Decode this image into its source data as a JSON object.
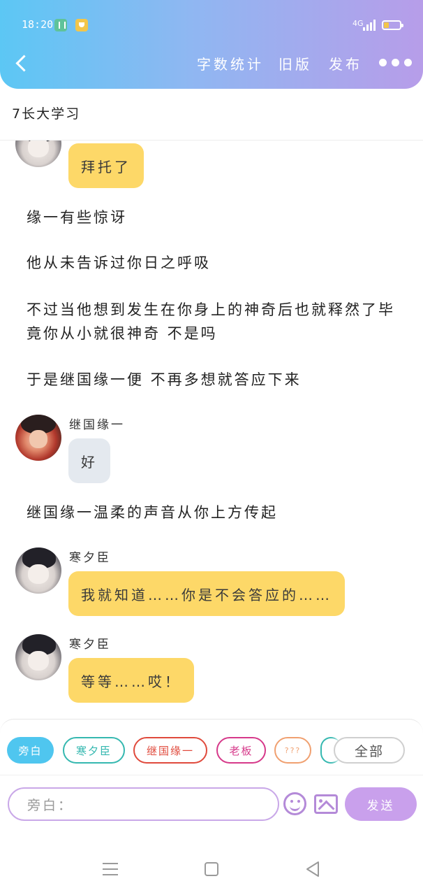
{
  "status_bar": {
    "time": "18:20",
    "network": "4G"
  },
  "header": {
    "nav": {
      "word_count": "字数统计",
      "old_version": "旧版",
      "publish": "发布"
    }
  },
  "story": {
    "title": "7长大学习"
  },
  "messages": [
    {
      "type": "bubble",
      "speaker": "",
      "avatar": "dark",
      "text": "拜托了",
      "style": "yellow"
    },
    {
      "type": "narration",
      "text": "缘一有些惊讶"
    },
    {
      "type": "narration",
      "text": "他从未告诉过你日之呼吸"
    },
    {
      "type": "narration",
      "text": "不过当他想到发生在你身上的神奇后也就释然了毕竟你从小就很神奇 不是吗"
    },
    {
      "type": "narration",
      "text": "于是继国缘一便 不再多想就答应下来"
    },
    {
      "type": "bubble",
      "speaker": "继国缘一",
      "avatar": "red",
      "text": "好",
      "style": "gray"
    },
    {
      "type": "narration",
      "text": "继国缘一温柔的声音从你上方传起"
    },
    {
      "type": "bubble",
      "speaker": "寒夕臣",
      "avatar": "dark",
      "text": "我就知道……你是不会答应的……",
      "style": "yellow"
    },
    {
      "type": "bubble",
      "speaker": "寒夕臣",
      "avatar": "dark",
      "text": "等等……哎！",
      "style": "yellow"
    }
  ],
  "roles": [
    {
      "label": "旁白",
      "selected": true
    },
    {
      "label": "寒夕臣",
      "selected": false
    },
    {
      "label": "继国缘一",
      "selected": false
    },
    {
      "label": "老板",
      "selected": false
    },
    {
      "label": "???",
      "selected": false
    },
    {
      "label": "",
      "selected": false
    }
  ],
  "roles_all_label": "全部",
  "composer": {
    "input_placeholder": "旁白：",
    "send_label": "发送"
  },
  "colors": {
    "header_gradient_start": "#5cc7f4",
    "header_gradient_end": "#b79de9",
    "bubble_yellow": "#fdd868",
    "bubble_gray": "#e4e9ef",
    "accent_purple": "#c9a0ec",
    "chip_selected": "#4fc6ef"
  }
}
